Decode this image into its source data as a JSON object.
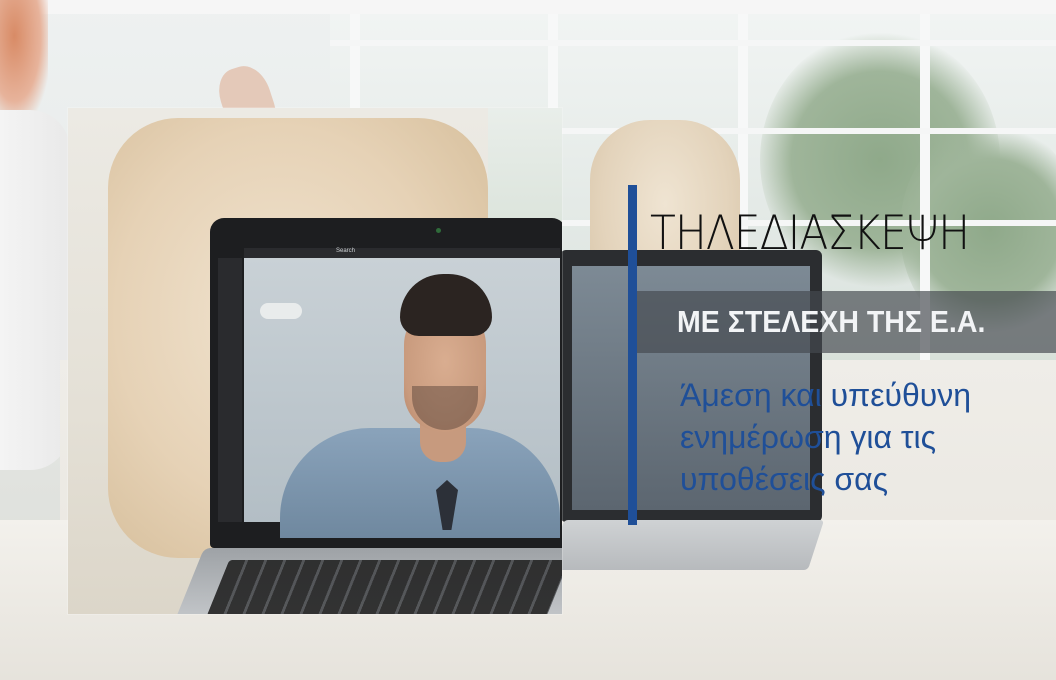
{
  "overlay": {
    "title": "ΤΗΛΕΔΙΑΣΚΕΨΗ",
    "subtitle": "ΜΕ ΣΤΕΛΕΧΗ ΤΗΣ Ε.Α.",
    "tagline_lines": [
      "Άμεση και υπεύθυνη",
      "ενημέρωση για τις",
      "υποθέσεις σας"
    ]
  },
  "laptop_screen": {
    "search_label": "Search"
  },
  "colors": {
    "accent_bar": "#1f4f98",
    "tagline_text": "#1f4f98",
    "title_text": "#111111",
    "subtitle_band": "#464a50",
    "subtitle_text": "#f2f4f6"
  }
}
